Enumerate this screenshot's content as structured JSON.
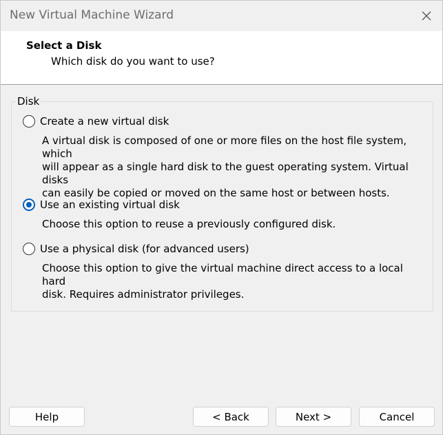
{
  "window": {
    "title": "New Virtual Machine Wizard"
  },
  "header": {
    "title": "Select a Disk",
    "subtitle": "Which disk do you want to use?"
  },
  "group": {
    "legend": "Disk",
    "options": [
      {
        "label": "Create a new virtual disk",
        "checked": false,
        "description_lines": [
          "A virtual disk is composed of one or more files on the host file system, which",
          "will appear as a single hard disk to the guest operating system. Virtual disks",
          "can easily be copied or moved on the same host or between hosts."
        ]
      },
      {
        "label": "Use an existing virtual disk",
        "checked": true,
        "description_lines": [
          "Choose this option to reuse a previously configured disk."
        ]
      },
      {
        "label": "Use a physical disk (for advanced users)",
        "checked": false,
        "description_lines": [
          "Choose this option to give the virtual machine direct access to a local hard",
          "disk. Requires administrator privileges."
        ]
      }
    ]
  },
  "buttons": {
    "help": "Help",
    "back": "< Back",
    "next": "Next >",
    "cancel": "Cancel"
  },
  "colors": {
    "accent": "#005fb8"
  },
  "icons": {
    "close": "close-icon"
  }
}
